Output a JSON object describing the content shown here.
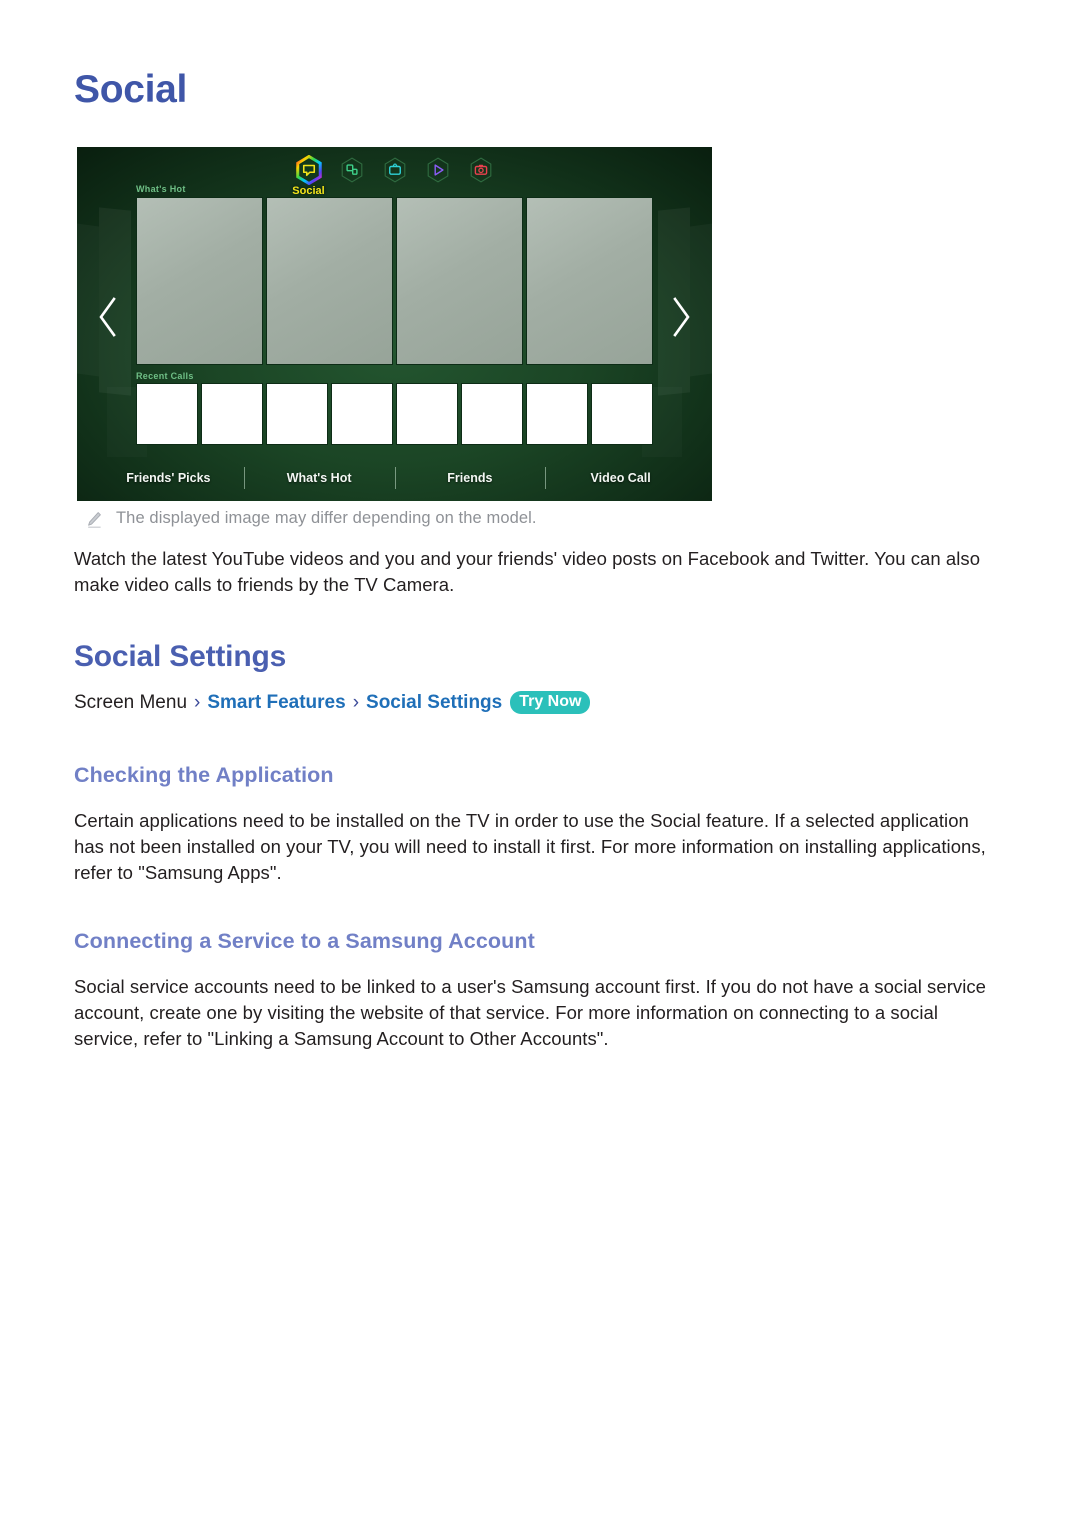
{
  "page": {
    "title": "Social"
  },
  "figure": {
    "tv": {
      "icons": [
        {
          "name": "social-hex-icon",
          "label": "Social",
          "selected": true
        },
        {
          "name": "apps-hex-icon",
          "label": "",
          "selected": false
        },
        {
          "name": "tv-hex-icon",
          "label": "",
          "selected": false
        },
        {
          "name": "play-hex-icon",
          "label": "",
          "selected": false
        },
        {
          "name": "camera-hex-icon",
          "label": "",
          "selected": false
        }
      ],
      "selected_app_label": "Social",
      "section_whats_hot": "What's Hot",
      "section_recent_calls": "Recent Calls",
      "tiles_count": 4,
      "call_thumbs_count": 8,
      "nav": [
        "Friends' Picks",
        "What's Hot",
        "Friends",
        "Video Call"
      ],
      "arrow_left": "‹",
      "arrow_right": "›",
      "colors": {
        "background_green": "#1b4525",
        "label_green": "#6fbf86",
        "selected_label_yellow": "#f2e41a",
        "tile_gray": "#a2aea4"
      }
    },
    "note": {
      "icon": "pencil-icon",
      "text": "The displayed image may differ depending on the model."
    }
  },
  "content": {
    "intro_paragraph": "Watch the latest YouTube videos and you and your friends' video posts on Facebook and Twitter. You can also make video calls to friends by the TV Camera.",
    "social_settings_heading": "Social Settings",
    "breadcrumb": {
      "root": "Screen Menu",
      "separator": "›",
      "level1": "Smart Features",
      "level2": "Social Settings",
      "badge": "Try Now",
      "badge_color": "#2bc0ba"
    },
    "checking_heading": "Checking the Application",
    "checking_paragraph": "Certain applications need to be installed on the TV in order to use the Social feature. If a selected application has not been installed on your TV, you will need to install it first. For more information on installing applications, refer to \"Samsung Apps\".",
    "connecting_heading": "Connecting a Service to a Samsung Account",
    "connecting_paragraph": "Social service accounts need to be linked to a user's Samsung account first. If you do not have a social service account, create one by visiting the website of that service. For more information on connecting to a social service, refer to \"Linking a Samsung Account to Other Accounts\"."
  },
  "theme": {
    "h1_color": "#3f56a8",
    "h2_color": "#4a5fb0",
    "h3_color": "#7180c6",
    "link_color": "#1f6fb8",
    "body_color": "#231f20",
    "note_color": "#8e9196"
  }
}
